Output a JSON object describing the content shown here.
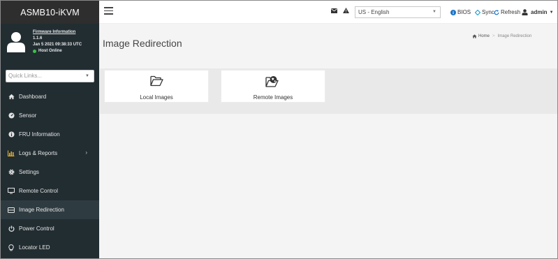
{
  "brand": "ASMB10-iKVM",
  "user_panel": {
    "fw_title": "Firmware Information",
    "version": "1.1.6",
    "date": "Jan 5 2021 09:38:33 UTC",
    "host_status": "Host Online",
    "status_color": "#3cc14a"
  },
  "quicklinks": {
    "placeholder": "Quick Links..."
  },
  "menu": [
    {
      "label": "Dashboard",
      "icon": "dashboard-icon"
    },
    {
      "label": "Sensor",
      "icon": "sensor-icon"
    },
    {
      "label": "FRU Information",
      "icon": "info-icon"
    },
    {
      "label": "Logs & Reports",
      "icon": "chart-icon",
      "has_submenu": true
    },
    {
      "label": "Settings",
      "icon": "gear-icon"
    },
    {
      "label": "Remote Control",
      "icon": "monitor-icon"
    },
    {
      "label": "Image Redirection",
      "icon": "drive-icon",
      "active": true
    },
    {
      "label": "Power Control",
      "icon": "power-icon"
    },
    {
      "label": "Locator LED",
      "icon": "lightbulb-icon"
    }
  ],
  "topbar": {
    "language": "US - English",
    "bios_label": "BIOS",
    "sync_label": "Sync",
    "refresh_label": "Refresh",
    "user_label": "admin",
    "link_color": "#1a73c7"
  },
  "page": {
    "title": "Image Redirection",
    "breadcrumb_home": "Home",
    "breadcrumb_current": "Image Redirection"
  },
  "cards": [
    {
      "label": "Local Images",
      "icon": "folder-open-icon"
    },
    {
      "label": "Remote Images",
      "icon": "remote-folder-icon"
    }
  ]
}
